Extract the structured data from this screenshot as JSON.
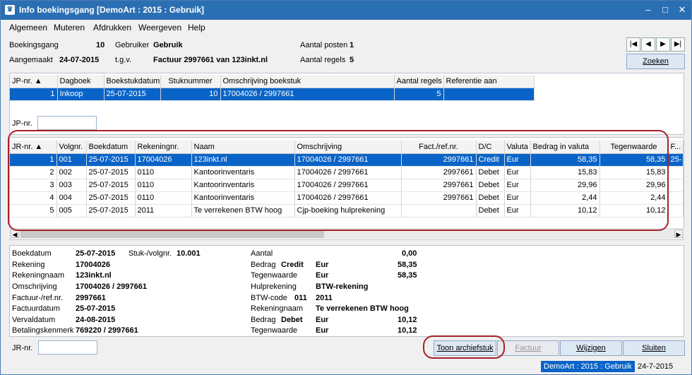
{
  "window": {
    "title": "Info boekingsgang [DemoArt : 2015 : Gebruik]",
    "min": "–",
    "max": "□",
    "close": "✕"
  },
  "menu": [
    "Algemeen",
    "Mutere",
    "Afdrukken",
    "Weergeven",
    "Help"
  ],
  "menu_full": [
    "Algemeen",
    "Muteren",
    "Afdrukken",
    "Weergeven",
    "Help"
  ],
  "header": {
    "boekingsgang_label": "Boekingsgang",
    "boekingsgang_value": "10",
    "gebruiker_label": "Gebruiker",
    "gebruiker_value": "Gebruik",
    "aantal_posten_label": "Aantal posten",
    "aantal_posten_value": "1",
    "aangemaakt_label": "Aangemaakt",
    "aangemaakt_value": "24-07-2015",
    "tgv_label": "t.g.v.",
    "tgv_value": "Factuur 2997661 van 123inkt.nl",
    "aantal_regels_label": "Aantal regels",
    "aantal_regels_value": "5",
    "zoeken": "Zoeken"
  },
  "jp_table": {
    "headers": [
      "JP-nr.",
      "Dagboek",
      "Boekstukdatum",
      "Stuknummer",
      "Omschrijving boekstuk",
      "Aantal regels",
      "Referentie aan"
    ],
    "rows": [
      [
        "1",
        "Inkoop",
        "25-07-2015",
        "10",
        "17004026 / 2997661",
        "5",
        ""
      ]
    ]
  },
  "jp_filter_label": "JP-nr.",
  "jr_table": {
    "headers": [
      "JR-nr.",
      "Volgnr.",
      "Boekdatum",
      "Rekeningnr.",
      "Naam",
      "Omschrijving",
      "Fact./ref.nr.",
      "D/C",
      "Valuta",
      "Bedrag in valuta",
      "Tegenwaarde",
      "F..."
    ],
    "rows": [
      [
        "1",
        "001",
        "25-07-2015",
        "17004026",
        "123inkt.nl",
        "17004026 / 2997661",
        "2997661",
        "Credit",
        "Eur",
        "58,35",
        "58,35",
        "25-"
      ],
      [
        "2",
        "002",
        "25-07-2015",
        "0110",
        "Kantoorinventaris",
        "17004026 / 2997661",
        "2997661",
        "Debet",
        "Eur",
        "15,83",
        "15,83",
        ""
      ],
      [
        "3",
        "003",
        "25-07-2015",
        "0110",
        "Kantoorinventaris",
        "17004026 / 2997661",
        "2997661",
        "Debet",
        "Eur",
        "29,96",
        "29,96",
        ""
      ],
      [
        "4",
        "004",
        "25-07-2015",
        "0110",
        "Kantoorinventaris",
        "17004026 / 2997661",
        "2997661",
        "Debet",
        "Eur",
        "2,44",
        "2,44",
        ""
      ],
      [
        "5",
        "005",
        "25-07-2015",
        "2011",
        "Te verrekenen BTW hoog",
        "Cjp-boeking hulprekening",
        "",
        "Debet",
        "Eur",
        "10,12",
        "10,12",
        ""
      ]
    ]
  },
  "detail_left": [
    {
      "label": "Boekdatum",
      "value": "25-07-2015"
    },
    {
      "label": "Rekening",
      "value": "17004026"
    },
    {
      "label": "Rekeningnaam",
      "value": "123inkt.nl"
    },
    {
      "label": "Omschrijving",
      "value": "17004026 / 2997661"
    },
    {
      "label": "Factuur-/ref.nr.",
      "value": "2997661"
    },
    {
      "label": "Factuurdatum",
      "value": "25-07-2015"
    },
    {
      "label": "Vervaldatum",
      "value": "24-08-2015"
    },
    {
      "label": "Betalingskenmerk",
      "value": "769220 / 2997661"
    }
  ],
  "stuk_label": "Stuk-/volgnr.",
  "stuk_value": "10.001",
  "detail_right": {
    "aantal_label": "Aantal",
    "aantal_value": "0,00",
    "bedrag1_label": "Bedrag",
    "bedrag1_dc": "Credit",
    "bedrag1_cur": "Eur",
    "bedrag1_value": "58,35",
    "tegen1_label": "Tegenwaarde",
    "tegen1_cur": "Eur",
    "tegen1_value": "58,35",
    "hulp_label": "Hulprekening",
    "hulp_value": "BTW-rekening",
    "btw_label": "BTW-code",
    "btw_code": "011",
    "btw_value": "2011",
    "reknaam_label": "Rekeningnaam",
    "reknaam_value": "Te verrekenen BTW hoog",
    "bedrag2_label": "Bedrag",
    "bedrag2_dc": "Debet",
    "bedrag2_cur": "Eur",
    "bedrag2_value": "10,12",
    "tegen2_label": "Tegenwaarde",
    "tegen2_cur": "Eur",
    "tegen2_value": "10,12"
  },
  "footer": {
    "jr_label": "JR-nr.",
    "toon": "Toon archiefstuk",
    "factuur": "Factuur",
    "wijzigen": "Wijzigen",
    "sluiten": "Sluiten"
  },
  "status": {
    "db": "DemoArt : 2015 : Gebruik",
    "date": "24-7-2015"
  }
}
